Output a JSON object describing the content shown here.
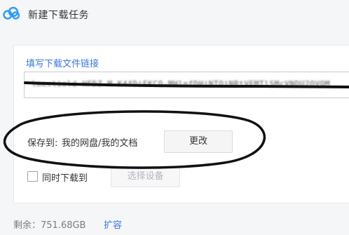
{
  "window": {
    "title": "新建下载任务",
    "logo_icon": "baidu-netdisk-cloud-icon"
  },
  "link_section": {
    "label": "填写下载文件链接",
    "value": "lmextield-HFDZ-M-K4fDiEKCQ-MHlnfDHiNTQiNRtVEMTlSMcVNDU2OVQM"
  },
  "save": {
    "label": "保存到:",
    "path": "我的网盘/我的文档",
    "change_button": "更改"
  },
  "sync": {
    "checkbox_label": "同时下载到",
    "checked": false,
    "device_button": "选择设备"
  },
  "footer": {
    "remaining": "剩余：751.68GB",
    "expand_link": "扩容"
  },
  "colors": {
    "accent": "#3b78d8",
    "logo": "#2f9af6"
  }
}
